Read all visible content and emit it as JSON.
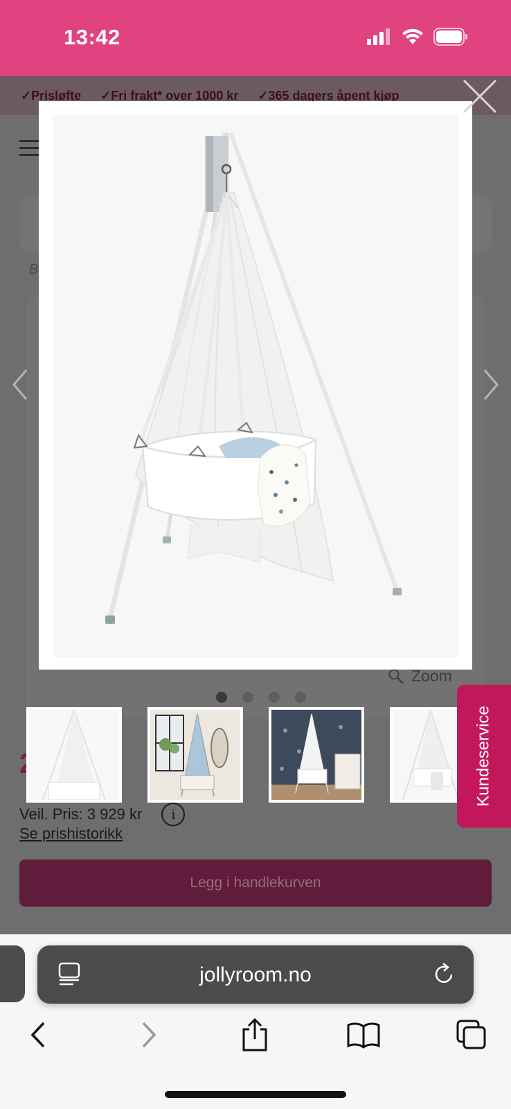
{
  "status_bar": {
    "time": "13:42",
    "icons": [
      "signal-icon",
      "wifi-icon",
      "battery-icon"
    ],
    "background": "#e0437f"
  },
  "usp_bar": {
    "items": [
      "Prisløfte",
      "Fri frakt* over 1000 kr",
      "365 dagers åpent kjøp"
    ]
  },
  "breadcrumb": {
    "text": "B"
  },
  "gallery": {
    "zoom_label": "Zoom",
    "dots_total": 4,
    "active_dot": 0,
    "thumbnails": [
      {
        "name": "hanging-cradle-white"
      },
      {
        "name": "cradle-room-blue"
      },
      {
        "name": "cradle-room-dark-wall"
      },
      {
        "name": "cradle-side-view"
      }
    ]
  },
  "product": {
    "price_partial": "2",
    "rrp_label": "Veil. Pris: 3 929 kr",
    "info_icon": "i",
    "history_link": "Se prishistorikk",
    "cart_button": "Legg i handlekurven",
    "accent": "#5f1d3b"
  },
  "support_tab": {
    "label": "Kundeservice",
    "color": "#c2185b"
  },
  "browser": {
    "url": "jollyroom.no",
    "toolbar": [
      "back-icon",
      "forward-icon",
      "share-icon",
      "bookmarks-icon",
      "tabs-icon"
    ]
  }
}
